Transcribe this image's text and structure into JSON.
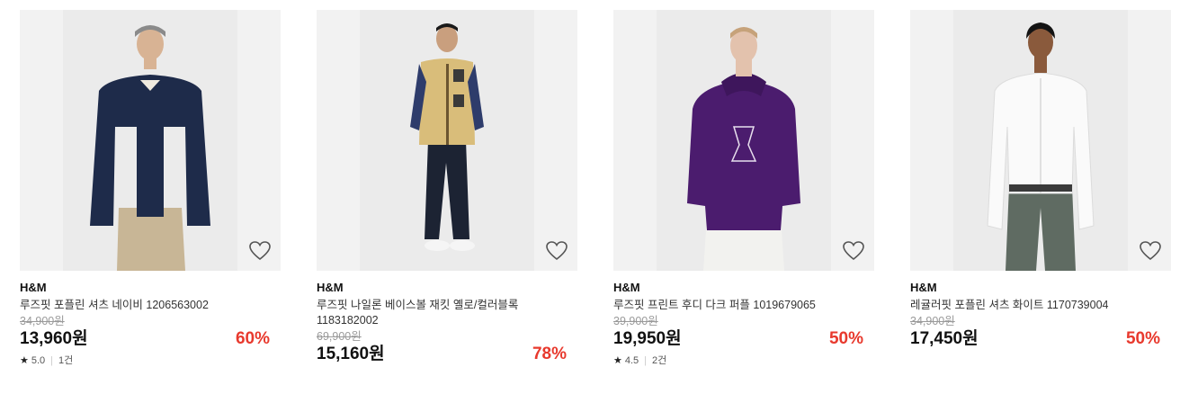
{
  "products": [
    {
      "brand": "H&M",
      "name": "루즈핏 포플린 셔츠 네이비 1206563002",
      "original_price": "34,900원",
      "price": "13,960원",
      "discount": "60%",
      "rating": "5.0",
      "reviews": "1건",
      "icon": "heart-outline-icon"
    },
    {
      "brand": "H&M",
      "name": "루즈핏 나일론 베이스볼 재킷 옐로/컬러블록 1183182002",
      "original_price": "69,900원",
      "price": "15,160원",
      "discount": "78%",
      "icon": "heart-outline-icon"
    },
    {
      "brand": "H&M",
      "name": "루즈핏 프린트 후디 다크 퍼플 1019679065",
      "original_price": "39,900원",
      "price": "19,950원",
      "discount": "50%",
      "rating": "4.5",
      "reviews": "2건",
      "icon": "heart-outline-icon"
    },
    {
      "brand": "H&M",
      "name": "레귤러핏 포플린 셔츠 화이트 1170739004",
      "original_price": "34,900원",
      "price": "17,450원",
      "discount": "50%",
      "icon": "heart-outline-icon"
    }
  ],
  "colors": {
    "discount": "#e8392d",
    "thumb_bg": "#f2f2f2",
    "strike": "#9a9a9a"
  }
}
